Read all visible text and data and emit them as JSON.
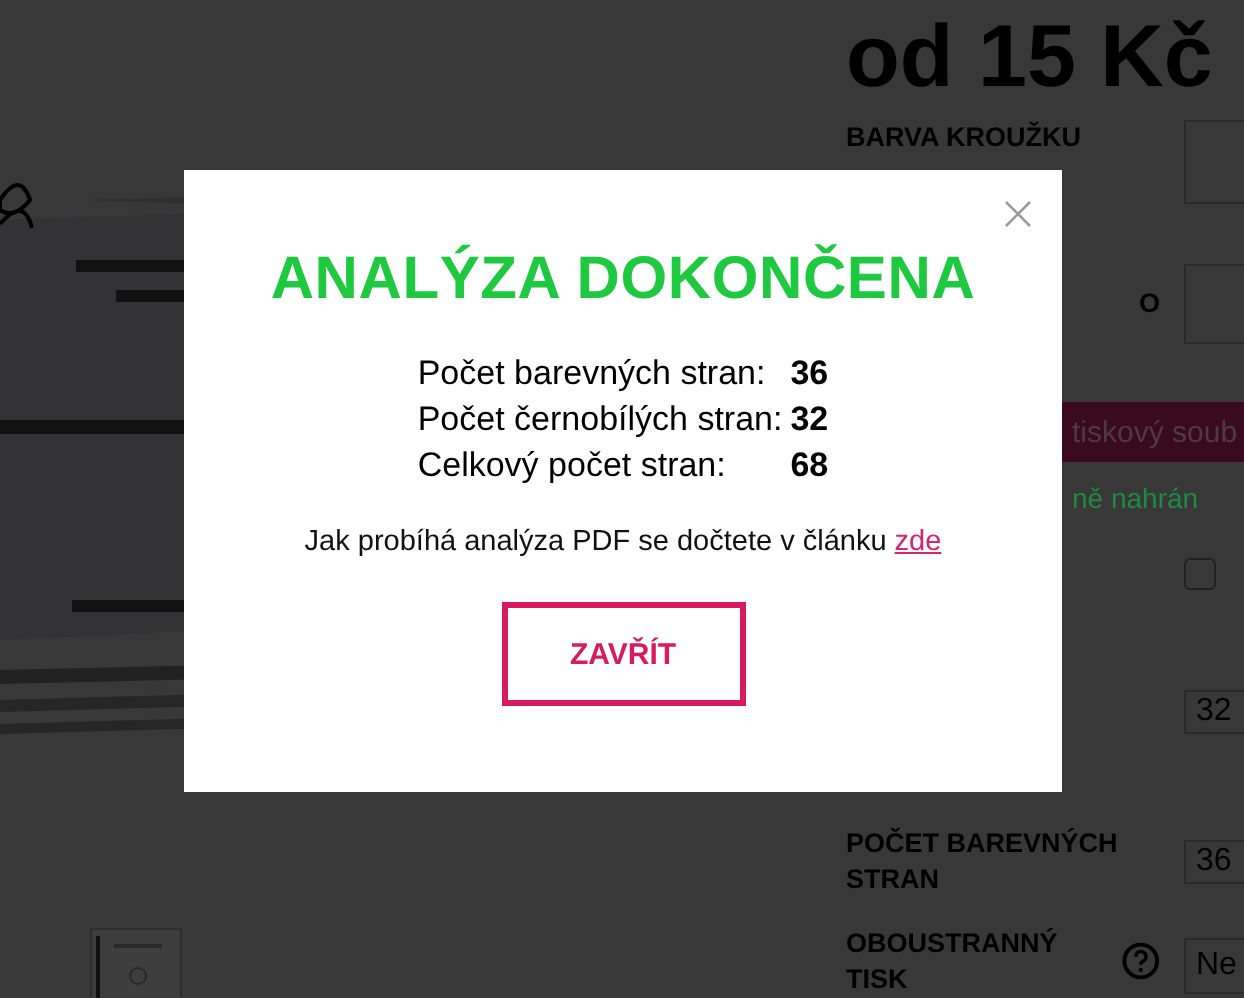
{
  "page": {
    "price_heading": "od 15 Kč",
    "form": [
      {
        "kind": "field",
        "label": "BARVA KROUŽKU"
      },
      {
        "kind": "field",
        "label": "O"
      },
      {
        "kind": "button",
        "label": "tiskový soub"
      },
      {
        "kind": "note",
        "text": "ně nahrán"
      },
      {
        "kind": "checkbox",
        "checked": false
      },
      {
        "kind": "field",
        "value": "32"
      },
      {
        "kind": "field",
        "label": "POČET BAREVNÝCH STRAN",
        "value": "36"
      },
      {
        "kind": "select",
        "label": "OBOUSTRANNÝ TISK",
        "value": "Ne"
      }
    ]
  },
  "modal": {
    "title": "ANALÝZA DOKONČENA",
    "stats": [
      {
        "label": "Počet barevných stran:",
        "value": "36"
      },
      {
        "label": "Počet černobílých stran:",
        "value": "32"
      },
      {
        "label": "Celkový počet stran:",
        "value": "68"
      }
    ],
    "note": "Jak probíhá analýza PDF se dočtete v článku",
    "link": "zde",
    "button": "ZAVŘÍT"
  }
}
